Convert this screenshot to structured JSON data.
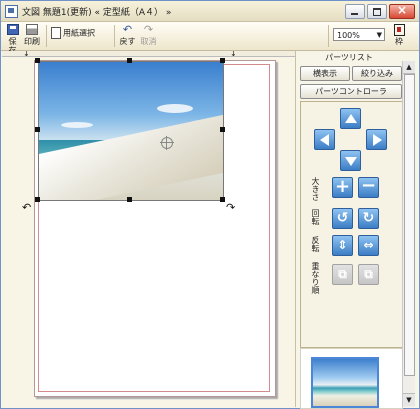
{
  "window": {
    "title": "文図  無題1(更新) « 定型紙（A４） »"
  },
  "toolbar": {
    "save": "保存",
    "print": "印刷",
    "paper_select": "用紙選択",
    "undo": "戻す",
    "redo": "取消",
    "frame": "枠"
  },
  "zoom": {
    "value": "100%"
  },
  "panel": {
    "title": "パーツリスト",
    "list_show": "横表示",
    "filter": "絞り込み",
    "parts_controller": "パーツコントローラ",
    "size_label": "大きさ",
    "rotate_label": "回転",
    "flip_label": "反転",
    "order_label": "重なり順"
  },
  "colors": {
    "accent": "#3c7dc5",
    "selection": "#4c86d6",
    "paper_border": "#d48b8b"
  },
  "icons": [
    "save-icon",
    "print-icon",
    "paper-icon",
    "undo-icon",
    "redo-icon",
    "frame-icon"
  ]
}
